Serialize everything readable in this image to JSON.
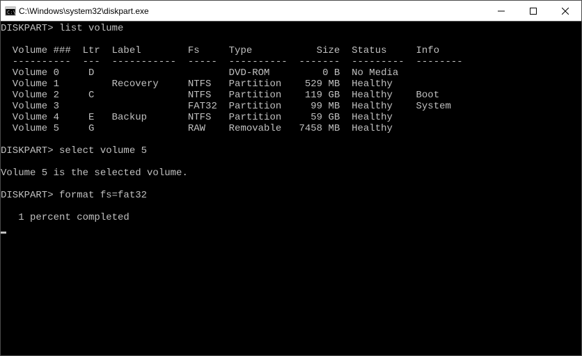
{
  "window": {
    "title": "C:\\Windows\\system32\\diskpart.exe"
  },
  "prompt": "DISKPART>",
  "commands": {
    "cmd1": "list volume",
    "cmd2": "select volume 5",
    "cmd3": "format fs=fat32"
  },
  "table": {
    "headers": {
      "volume": "Volume ###",
      "ltr": "Ltr",
      "label": "Label",
      "fs": "Fs",
      "type": "Type",
      "size": "Size",
      "status": "Status",
      "info": "Info"
    },
    "rows": [
      {
        "vol": "Volume 0",
        "ltr": "D",
        "label": "",
        "fs": "",
        "type": "DVD-ROM",
        "size": "0 B",
        "status": "No Media",
        "info": ""
      },
      {
        "vol": "Volume 1",
        "ltr": "",
        "label": "Recovery",
        "fs": "NTFS",
        "type": "Partition",
        "size": "529 MB",
        "status": "Healthy",
        "info": ""
      },
      {
        "vol": "Volume 2",
        "ltr": "C",
        "label": "",
        "fs": "NTFS",
        "type": "Partition",
        "size": "119 GB",
        "status": "Healthy",
        "info": "Boot"
      },
      {
        "vol": "Volume 3",
        "ltr": "",
        "label": "",
        "fs": "FAT32",
        "type": "Partition",
        "size": "99 MB",
        "status": "Healthy",
        "info": "System"
      },
      {
        "vol": "Volume 4",
        "ltr": "E",
        "label": "Backup",
        "fs": "NTFS",
        "type": "Partition",
        "size": "59 GB",
        "status": "Healthy",
        "info": ""
      },
      {
        "vol": "Volume 5",
        "ltr": "G",
        "label": "",
        "fs": "RAW",
        "type": "Removable",
        "size": "7458 MB",
        "status": "Healthy",
        "info": ""
      }
    ]
  },
  "messages": {
    "selected": "Volume 5 is the selected volume.",
    "progress": "1 percent completed"
  },
  "column_widths": {
    "indent": 2,
    "vol": 12,
    "ltr": 5,
    "label": 13,
    "fs": 7,
    "type": 12,
    "size": 9,
    "status": 11,
    "info": 8
  },
  "separators": {
    "vol": "----------",
    "ltr": "---",
    "label": "-----------",
    "fs": "-----",
    "type": "----------",
    "size": "-------",
    "status": "---------",
    "info": "--------"
  }
}
